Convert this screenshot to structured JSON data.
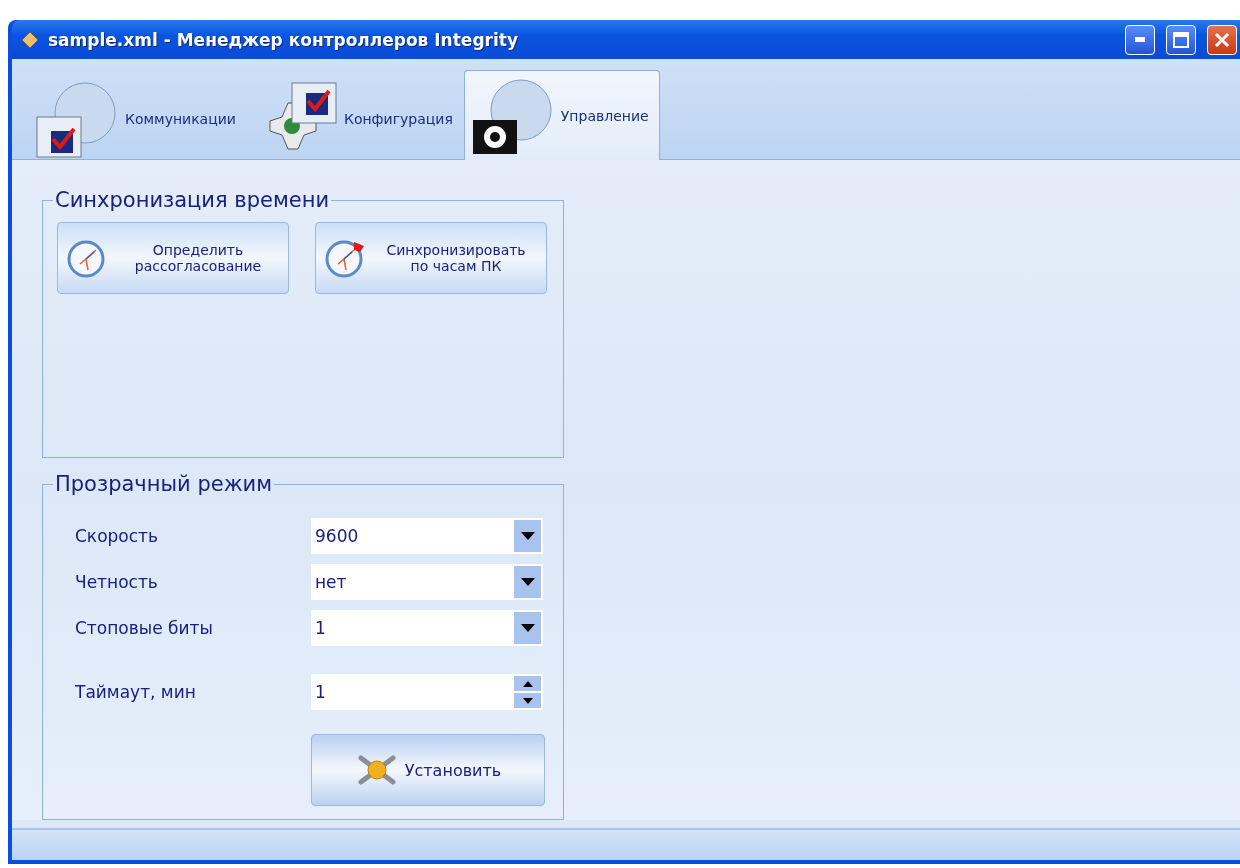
{
  "window": {
    "title": "sample.xml - Менеджер контроллеров Integrity"
  },
  "tabs": [
    {
      "label": "Коммуникации",
      "selected": false
    },
    {
      "label": "Конфигурация",
      "selected": false
    },
    {
      "label": "Управление",
      "selected": true
    }
  ],
  "time_sync": {
    "title": "Синхронизация времени",
    "buttons": [
      {
        "label": "Определить\nрассогласование"
      },
      {
        "label": "Синхронизировать\nпо часам ПК"
      }
    ]
  },
  "transparent_mode": {
    "title": "Прозрачный режим",
    "fields": [
      {
        "label": "Скорость",
        "value": "9600",
        "kind": "dropdown"
      },
      {
        "label": "Четность",
        "value": "нет",
        "kind": "dropdown"
      },
      {
        "label": "Стоповые биты",
        "value": "1",
        "kind": "dropdown"
      },
      {
        "label": "Таймаут, мин",
        "value": "1",
        "kind": "spinner"
      }
    ],
    "button": {
      "label": "Установить"
    }
  }
}
